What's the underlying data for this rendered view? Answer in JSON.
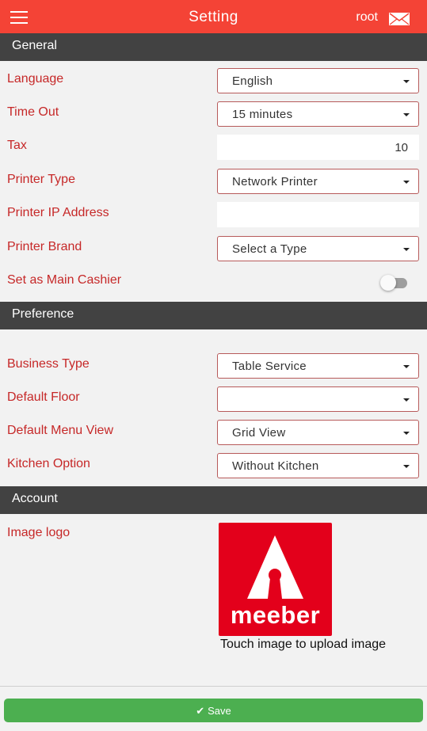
{
  "header": {
    "title": "Setting",
    "user": "root"
  },
  "general": {
    "section_title": "General",
    "language_label": "Language",
    "language_value": "English",
    "timeout_label": "Time Out",
    "timeout_value": "15 minutes",
    "tax_label": "Tax",
    "tax_value": "10",
    "printer_type_label": "Printer Type",
    "printer_type_value": "Network Printer",
    "printer_ip_label": "Printer IP Address",
    "printer_ip_value": "",
    "printer_brand_label": "Printer Brand",
    "printer_brand_value": "Select a Type",
    "main_cashier_label": "Set as Main Cashier",
    "main_cashier_enabled": false
  },
  "preference": {
    "section_title": "Preference",
    "business_type_label": "Business Type",
    "business_type_value": "Table Service",
    "default_floor_label": "Default Floor",
    "default_floor_value": "",
    "menu_view_label": "Default Menu View",
    "menu_view_value": "Grid View",
    "kitchen_option_label": "Kitchen Option",
    "kitchen_option_value": "Without Kitchen"
  },
  "account": {
    "section_title": "Account",
    "image_logo_label": "Image logo",
    "logo_text": "meeber",
    "upload_hint": "Touch image to upload image"
  },
  "footer": {
    "save_label": "Save"
  },
  "colors": {
    "topbar": "#f44336",
    "section_header": "#424242",
    "label": "#c62828",
    "save": "#4caf50",
    "logo_bg": "#e3001b"
  }
}
